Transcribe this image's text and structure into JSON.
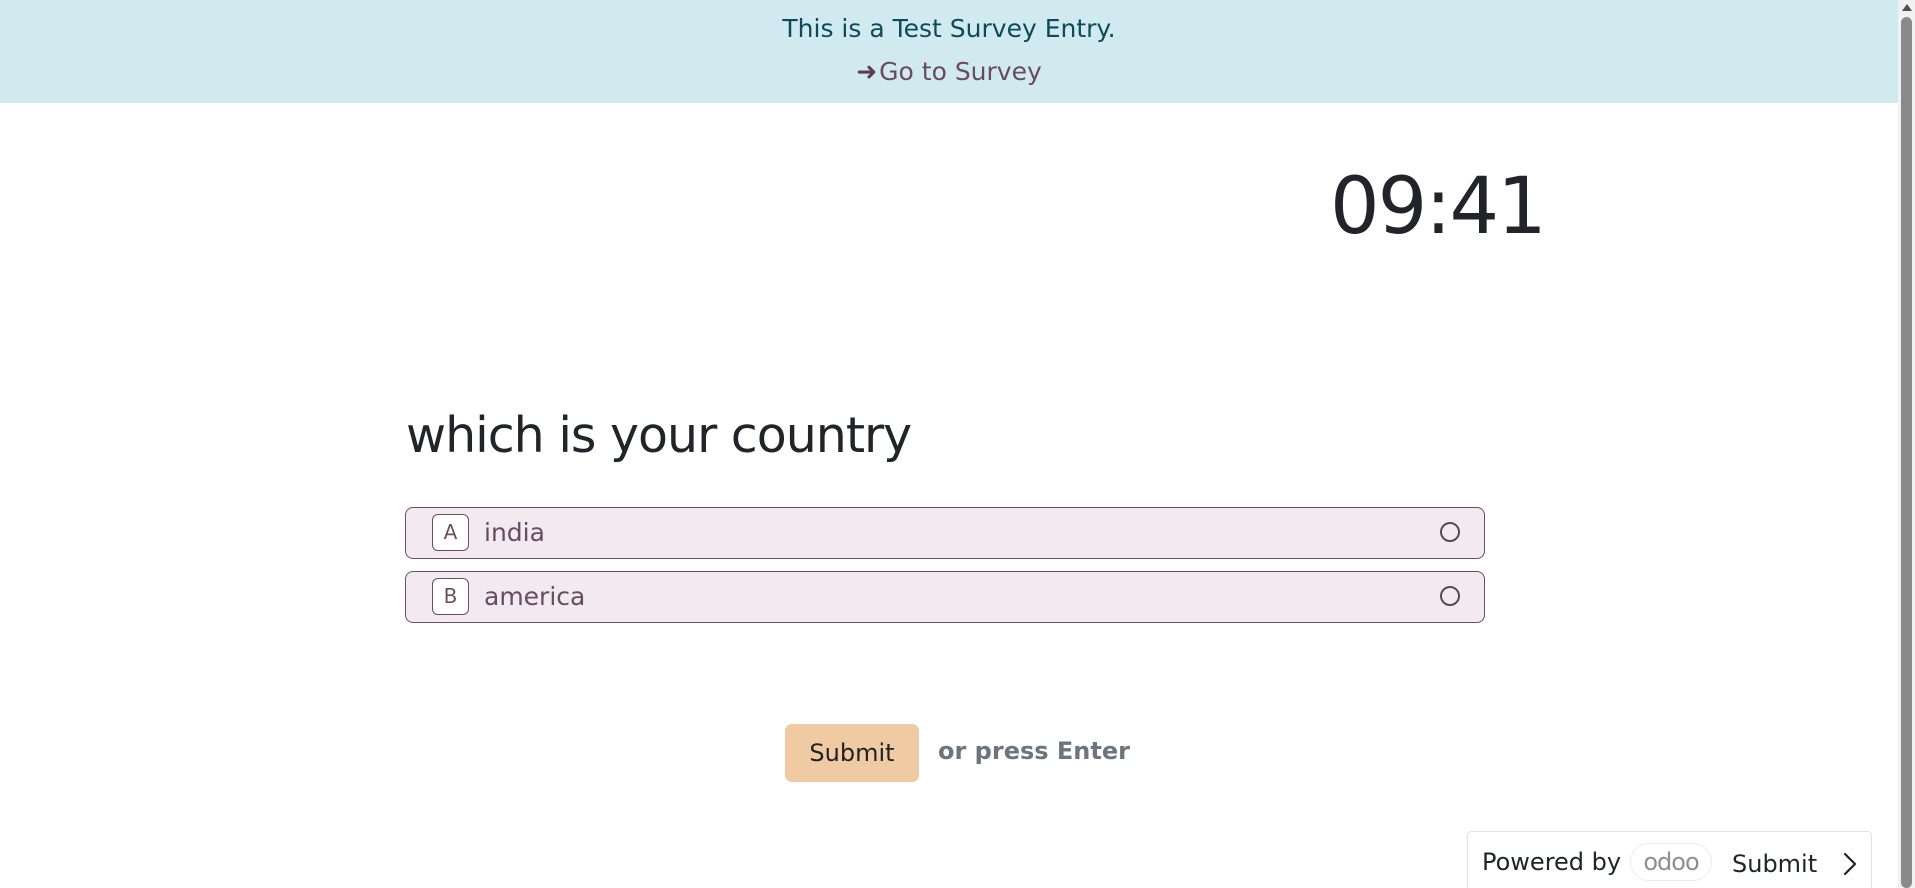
{
  "banner": {
    "text": "This is a Test Survey Entry.",
    "link_arrow": "➜",
    "link_label": "Go to Survey"
  },
  "timer": {
    "value": "09:41"
  },
  "question": {
    "title": "which is your country",
    "choices": [
      {
        "key": "A",
        "label": "india",
        "selected": false
      },
      {
        "key": "B",
        "label": "america",
        "selected": false
      }
    ]
  },
  "actions": {
    "submit_label": "Submit",
    "hint": "or press Enter"
  },
  "footer": {
    "powered_by": "Powered by",
    "logo_text": "odoo",
    "submit_label": "Submit",
    "chevron_icon": "chevron-right-icon"
  },
  "colors": {
    "banner_bg": "#d0eaf0",
    "accent": "#714b67",
    "choice_bg": "#f1eaef",
    "submit_bg": "#f0caa2"
  }
}
